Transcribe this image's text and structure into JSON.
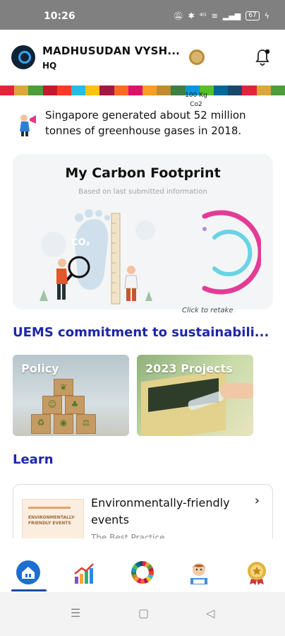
{
  "status_bar": {
    "time": "10:26",
    "icons_text": "⁴ᴳ",
    "battery": "67"
  },
  "header": {
    "user_name": "MADHUSUDAN VYSH...",
    "user_location": "HQ"
  },
  "sdg_colors": [
    "#e5243b",
    "#dda63a",
    "#4c9f38",
    "#c5192d",
    "#ff3a21",
    "#26bde2",
    "#fcc30b",
    "#a21942",
    "#fd6925",
    "#dd1367",
    "#fd9d24",
    "#bf8b2e",
    "#3f7e44",
    "#0a97d9",
    "#56c02b",
    "#00689d",
    "#19486a",
    "#e5243b",
    "#dda63a",
    "#4c9f38"
  ],
  "fact": {
    "text": "Singapore generated about 52 million tonnes of greenhouse gases in 2018."
  },
  "carbon_card": {
    "title": "My Carbon Footprint",
    "subtitle": "Based on last submitted information",
    "co2_label": "CO₂",
    "gauge_value": "100 Kg",
    "gauge_unit": "Co2",
    "retake": "Click to retake"
  },
  "commitment": {
    "title": "UEMS commitment to sustainabili...",
    "tiles": [
      {
        "label": "Policy"
      },
      {
        "label": "2023 Projects"
      }
    ]
  },
  "learn": {
    "title": "Learn",
    "card": {
      "heading": "Environmentally-friendly events",
      "subtext": "The Best Practice",
      "thumb_text": "ENVIRONMENTALLY-FRIENDLY EVENTS"
    }
  },
  "bottom_nav": {
    "items": [
      "home-icon",
      "trend-chart-icon",
      "sdg-wheel-icon",
      "profile-reading-icon",
      "badge-medal-icon"
    ],
    "active": "home-icon"
  },
  "colors": {
    "accent": "#1c27a8",
    "gauge_outer": "#e23c97",
    "gauge_inner": "#69d3e6"
  }
}
